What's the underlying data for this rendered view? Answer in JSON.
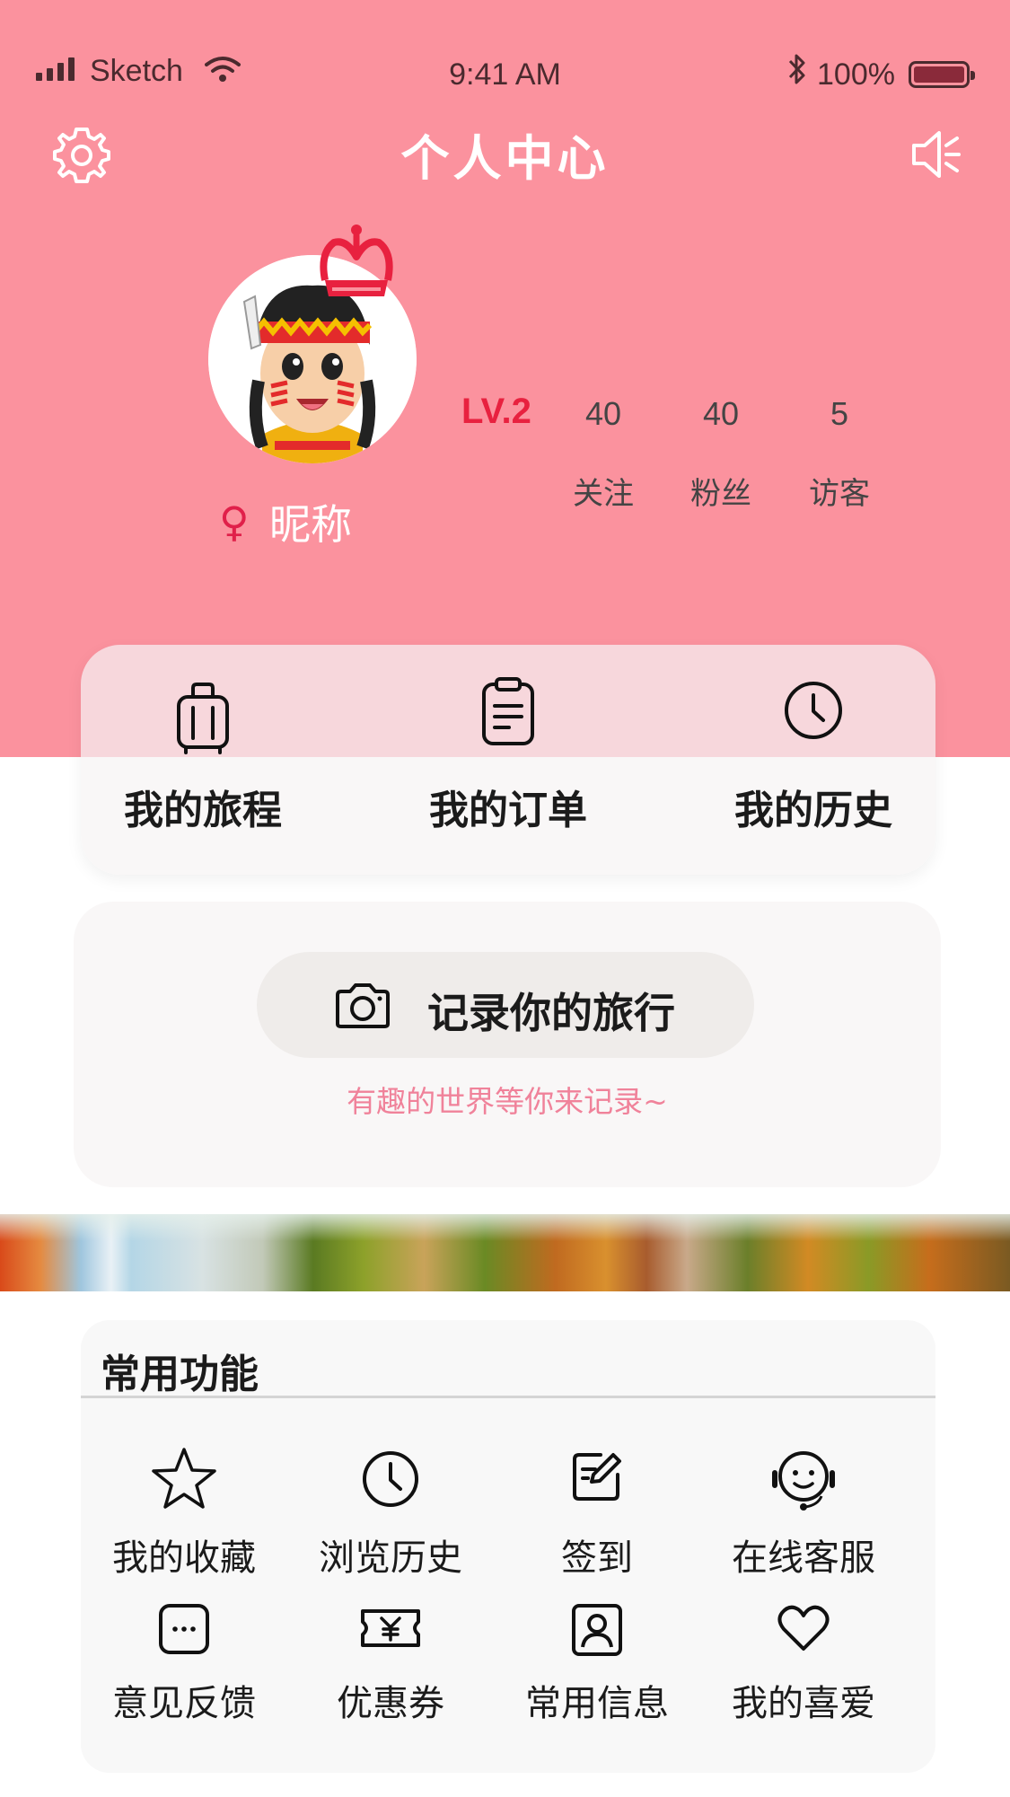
{
  "status_bar": {
    "carrier": "Sketch",
    "time": "9:41 AM",
    "battery": "100%"
  },
  "nav": {
    "title": "个人中心"
  },
  "profile": {
    "gender_symbol": "♀",
    "nickname": "昵称",
    "level": "LV.2",
    "stats": [
      {
        "value": "40",
        "label": "关注"
      },
      {
        "value": "40",
        "label": "粉丝"
      },
      {
        "value": "5",
        "label": "访客"
      }
    ]
  },
  "quick": {
    "items": [
      {
        "label": "我的旅程",
        "icon": "luggage-icon"
      },
      {
        "label": "我的订单",
        "icon": "clipboard-icon"
      },
      {
        "label": "我的历史",
        "icon": "clock-icon"
      }
    ]
  },
  "record": {
    "button_label": "记录你的旅行",
    "subtitle": "有趣的世界等你来记录~"
  },
  "features": {
    "title": "常用功能",
    "items": [
      {
        "label": "我的收藏",
        "icon": "star-icon"
      },
      {
        "label": "浏览历史",
        "icon": "clock-icon"
      },
      {
        "label": "签到",
        "icon": "edit-icon"
      },
      {
        "label": "在线客服",
        "icon": "headset-icon"
      },
      {
        "label": "意见反馈",
        "icon": "chat-icon"
      },
      {
        "label": "优惠券",
        "icon": "coupon-icon"
      },
      {
        "label": "常用信息",
        "icon": "contact-icon"
      },
      {
        "label": "我的喜爱",
        "icon": "heart-icon"
      }
    ]
  },
  "colors": {
    "header_pink": "#fb929e",
    "level_red": "#e8213f",
    "subtitle_pink": "#f0829a"
  }
}
